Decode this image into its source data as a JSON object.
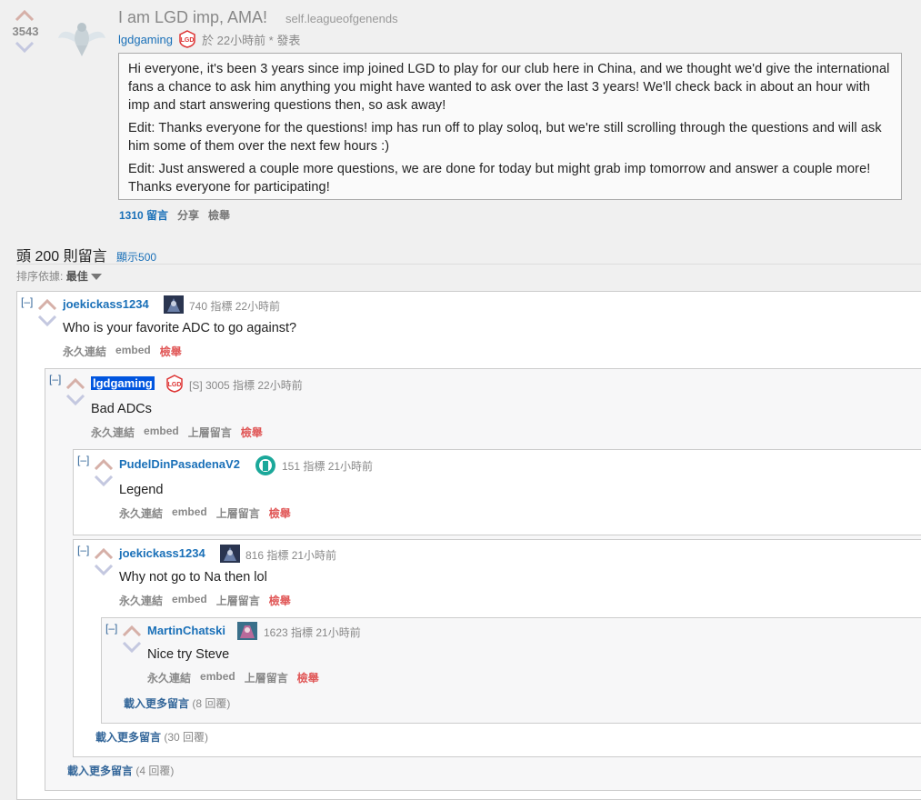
{
  "post": {
    "score": "3543",
    "title": "I am LGD imp, AMA!",
    "domain": "self.leagueofgenends",
    "author": "lgdgaming",
    "time": "於 22小時前 * 發表",
    "paragraphs": [
      "Hi everyone, it's been 3 years since imp joined LGD to play for our club here in China, and we thought we'd give the international fans a chance to ask him anything you might have wanted to ask over the last 3 years! We'll check back in about an hour with imp and start answering questions then, so ask away!",
      "Edit: Thanks everyone for the questions! imp has run off to play soloq, but we're still scrolling through the questions and will ask him some of them over the next few hours :)",
      "Edit: Just answered a couple more questions, we are done for today but might grab imp tomorrow and answer a couple more! Thanks everyone for participating!"
    ],
    "buttons": {
      "comments": "1310 留言",
      "share": "分享",
      "report": "檢舉"
    },
    "thumb_icon": "guardian-angel-icon",
    "flair_icon": "lgd-logo-icon"
  },
  "comments_section": {
    "title": "頭 200 則留言",
    "show_more": "顯示500",
    "sort_label": "排序依據:",
    "sort_value": "最佳"
  },
  "comments": [
    {
      "toggle": "[–]",
      "author": "joekickass1234",
      "meta": "740 指標 22小時前",
      "body": "Who is your favorite ADC to go against?",
      "buttons": {
        "permalink": "永久連結",
        "embed": "embed",
        "report": "檢舉"
      }
    },
    {
      "toggle": "[–]",
      "author": "lgdgaming",
      "meta": "[S] 3005 指標 22小時前",
      "body": "Bad ADCs",
      "buttons": {
        "permalink": "永久連結",
        "embed": "embed",
        "parent": "上層留言",
        "report": "檢舉"
      }
    },
    {
      "toggle": "[–]",
      "author": "PudelDinPasadenaV2",
      "meta": "151 指標 21小時前",
      "body": "Legend",
      "buttons": {
        "permalink": "永久連結",
        "embed": "embed",
        "parent": "上層留言",
        "report": "檢舉"
      }
    },
    {
      "toggle": "[–]",
      "author": "joekickass1234",
      "meta": "816 指標 21小時前",
      "body": "Why not go to Na then lol",
      "buttons": {
        "permalink": "永久連結",
        "embed": "embed",
        "parent": "上層留言",
        "report": "檢舉"
      }
    },
    {
      "toggle": "[–]",
      "author": "MartinChatski",
      "meta": "1623 指標 21小時前",
      "body": "Nice try Steve",
      "buttons": {
        "permalink": "永久連結",
        "embed": "embed",
        "parent": "上層留言",
        "report": "檢舉"
      }
    }
  ],
  "load_more": [
    {
      "label": "載入更多留言",
      "count": "(8 回覆)"
    },
    {
      "label": "載入更多留言",
      "count": "(30 回覆)"
    },
    {
      "label": "載入更多留言",
      "count": "(4 回覆)"
    }
  ],
  "colors": {
    "link": "#1a70b8",
    "report": "#e05555",
    "op_highlight": "#0055df",
    "upvote": "#c8a098",
    "downvote": "#b8bcd8"
  }
}
